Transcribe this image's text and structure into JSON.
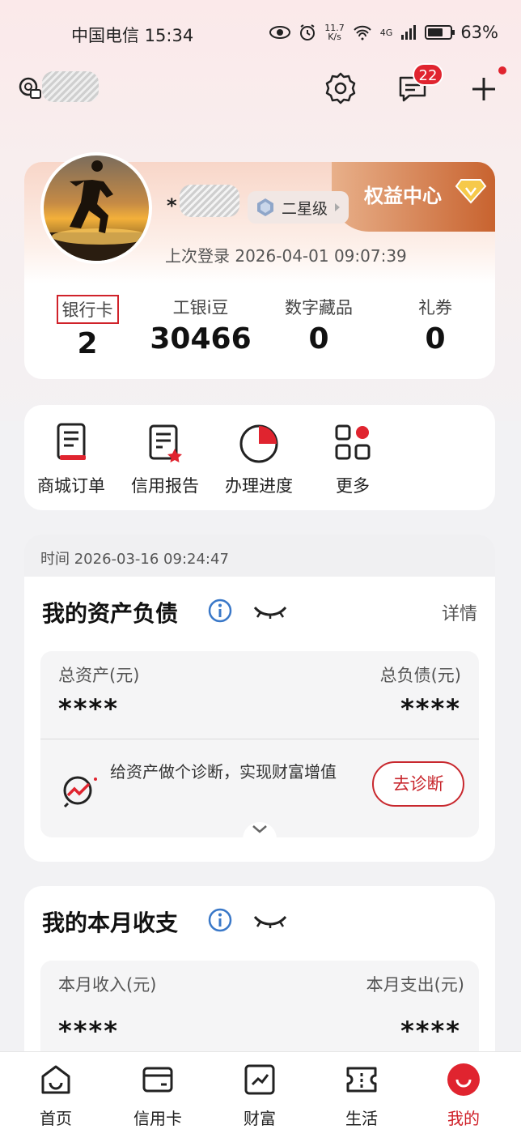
{
  "status_bar": {
    "carrier_time": "中国电信 15:34",
    "net_speed": "11.7",
    "net_unit": "K/s",
    "net_type": "4G",
    "battery": "63%"
  },
  "header": {
    "message_badge": "22"
  },
  "profile": {
    "name_prefix": "*",
    "level": "二星级",
    "rights_center": "权益中心",
    "last_login": "上次登录 2026-04-01 09:07:39",
    "stats": [
      {
        "label": "银行卡",
        "value": "2"
      },
      {
        "label": "工银i豆",
        "value": "30466"
      },
      {
        "label": "数字藏品",
        "value": "0"
      },
      {
        "label": "礼券",
        "value": "0"
      }
    ]
  },
  "shortcuts": [
    {
      "label": "商城订单",
      "icon": "order-icon"
    },
    {
      "label": "信用报告",
      "icon": "credit-report-icon"
    },
    {
      "label": "办理进度",
      "icon": "progress-icon"
    },
    {
      "label": "更多",
      "icon": "more-grid-icon"
    }
  ],
  "assets": {
    "time": "时间 2026-03-16 09:24:47",
    "title": "我的资产负债",
    "detail": "详情",
    "total_assets_label": "总资产(元)",
    "total_assets_value": "****",
    "total_liabilities_label": "总负债(元)",
    "total_liabilities_value": "****",
    "diagnosis_text": "给资产做个诊断，实现财富增值",
    "diagnosis_button": "去诊断"
  },
  "income": {
    "title": "我的本月收支",
    "income_label": "本月收入(元)",
    "income_value": "****",
    "expense_label": "本月支出(元)",
    "expense_value": "****"
  },
  "bottom_nav": [
    {
      "label": "首页",
      "icon": "home-icon"
    },
    {
      "label": "信用卡",
      "icon": "credit-card-icon"
    },
    {
      "label": "财富",
      "icon": "wealth-icon"
    },
    {
      "label": "生活",
      "icon": "life-ticket-icon"
    },
    {
      "label": "我的",
      "icon": "me-icon",
      "active": true
    }
  ],
  "colors": {
    "accent": "#d0222a",
    "rights_center_bg": "#c8632f"
  }
}
